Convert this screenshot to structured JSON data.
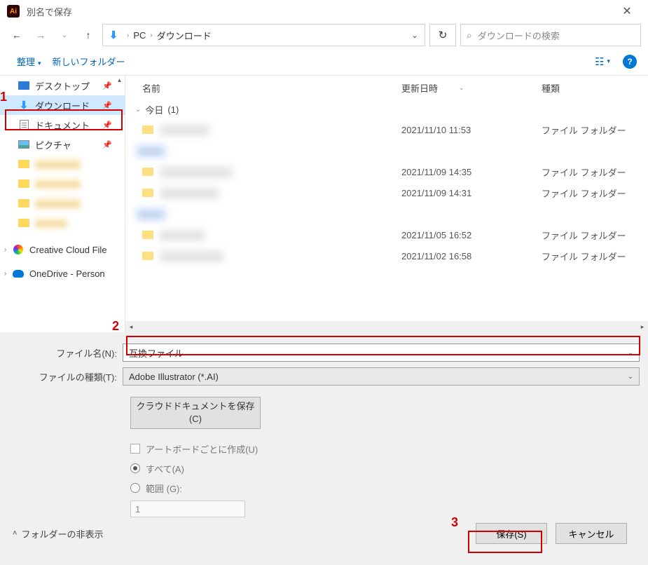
{
  "title": "別名で保存",
  "breadcrumb": {
    "root": "PC",
    "path": "ダウンロード"
  },
  "search": {
    "placeholder": "ダウンロードの検索"
  },
  "toolbar": {
    "organize": "整理",
    "newfolder": "新しいフォルダー"
  },
  "sidebar": {
    "items": [
      {
        "label": "デスクトップ",
        "icon": "desktop",
        "pinned": true
      },
      {
        "label": "ダウンロード",
        "icon": "download",
        "pinned": true,
        "selected": true
      },
      {
        "label": "ドキュメント",
        "icon": "document",
        "pinned": true
      },
      {
        "label": "ピクチャ",
        "icon": "picture",
        "pinned": true
      }
    ],
    "cloud": {
      "cc": "Creative Cloud File",
      "od": "OneDrive - Person"
    }
  },
  "columns": {
    "name": "名前",
    "date": "更新日時",
    "type": "種類"
  },
  "group_today": {
    "label": "今日",
    "count": "(1)"
  },
  "file_type_label": "ファイル フォルダー",
  "dates": {
    "r1": "2021/11/10 11:53",
    "r2": "2021/11/09 14:35",
    "r3": "2021/11/09 14:31",
    "r4": "2021/11/05 16:52",
    "r5": "2021/11/02 16:58"
  },
  "form": {
    "filename_label": "ファイル名(N):",
    "filename_value": "互換ファイル",
    "filetype_label": "ファイルの種類(T):",
    "filetype_value": "Adobe Illustrator (*.AI)",
    "cloud_btn": "クラウドドキュメントを保存(C)",
    "cb_artboard": "アートボードごとに作成(U)",
    "rb_all": "すべて(A)",
    "rb_range": "範囲 (G):",
    "range_value": "1"
  },
  "footer": {
    "hide": "フォルダーの非表示",
    "save": "保存(S)",
    "cancel": "キャンセル"
  },
  "anno": {
    "n1": "1",
    "n2": "2",
    "n3": "3"
  }
}
